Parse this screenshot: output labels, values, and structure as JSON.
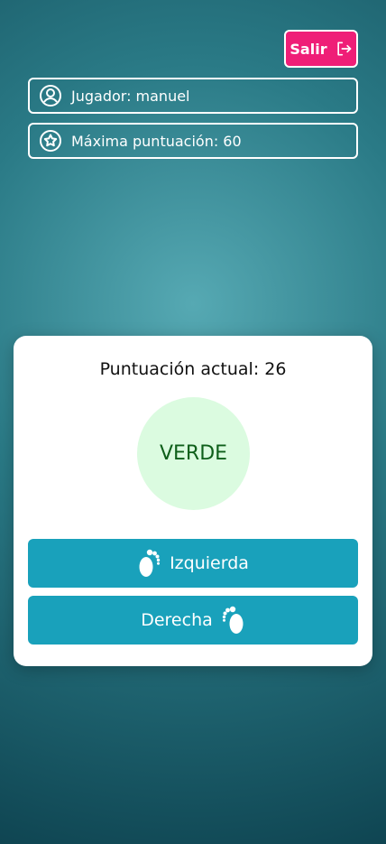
{
  "header": {
    "logout_label": "Salir",
    "logout_icon": "logout-icon",
    "player_label": "Jugador: manuel",
    "player_icon": "user-circle-icon",
    "best_score_label": "Máxima puntuación: 60",
    "best_score_icon": "star-circle-icon"
  },
  "game": {
    "score_label": "Puntuación actual:",
    "score_value": "26",
    "color_word": "VERDE",
    "left_button_label": "Izquierda",
    "left_button_icon": "footprint-icon",
    "right_button_label": "Derecha",
    "right_button_icon": "footprint-icon"
  },
  "colors": {
    "logout_bg": "#ef1e77",
    "button_bg": "#19a1bb",
    "circle_bg": "#dbfbe0",
    "circle_text": "#0e5f1a"
  }
}
